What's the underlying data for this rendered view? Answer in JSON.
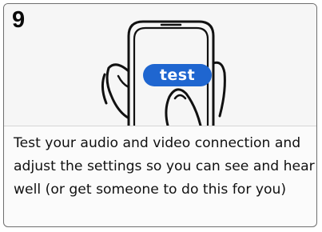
{
  "step": {
    "number": "9",
    "button_label": "test",
    "description": "Test your audio and video connection and adjust the settings so you can see and hear well (or get someone to do this for you)"
  },
  "icons": [
    "phone-illustration",
    "left-hand-icon",
    "right-finger-icon"
  ],
  "colors": {
    "accent": "#1f66d0",
    "card_border": "#6e6e6e",
    "line_art": "#111111"
  }
}
